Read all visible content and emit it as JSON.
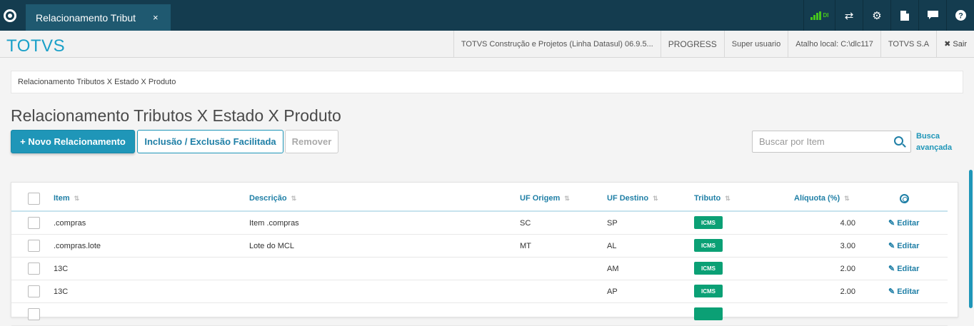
{
  "topbar": {
    "tab_title": "Relacionamento Tribut",
    "tab_close": "×",
    "signal_label": "DI"
  },
  "header": {
    "brand": "TOTVS",
    "company": "TOTVS Construção e Projetos (Linha Datasul) 06.9.5...",
    "database": "PROGRESS",
    "user": "Super usuario",
    "shortcut": "Atalho local: C:\\dlc117",
    "org": "TOTVS S.A",
    "logout": "✖ Sair"
  },
  "breadcrumb": "Relacionamento Tributos X Estado X Produto",
  "page_title": "Relacionamento Tributos X Estado X Produto",
  "actions": {
    "new": "+ Novo Relacionamento",
    "bulk": "Inclusão / Exclusão Facilitada",
    "remove": "Remover"
  },
  "search": {
    "placeholder": "Buscar por Item",
    "advanced": "Busca avançada"
  },
  "table": {
    "columns": {
      "item": "Item",
      "descricao": "Descrição",
      "uf_origem": "UF Origem",
      "uf_destino": "UF Destino",
      "tributo": "Tributo",
      "aliquota": "Alíquota (%)"
    },
    "edit_label": "Editar",
    "rows": [
      {
        "item": ".compras",
        "descricao": "Item .compras",
        "uf_origem": "SC",
        "uf_destino": "SP",
        "tributo": "ICMS",
        "aliquota": "4.00"
      },
      {
        "item": ".compras.lote",
        "descricao": "Lote do MCL",
        "uf_origem": "MT",
        "uf_destino": "AL",
        "tributo": "ICMS",
        "aliquota": "3.00"
      },
      {
        "item": "13C",
        "descricao": "",
        "uf_origem": "",
        "uf_destino": "AM",
        "tributo": "ICMS",
        "aliquota": "2.00"
      },
      {
        "item": "13C",
        "descricao": "",
        "uf_origem": "",
        "uf_destino": "AP",
        "tributo": "ICMS",
        "aliquota": "2.00"
      }
    ]
  }
}
